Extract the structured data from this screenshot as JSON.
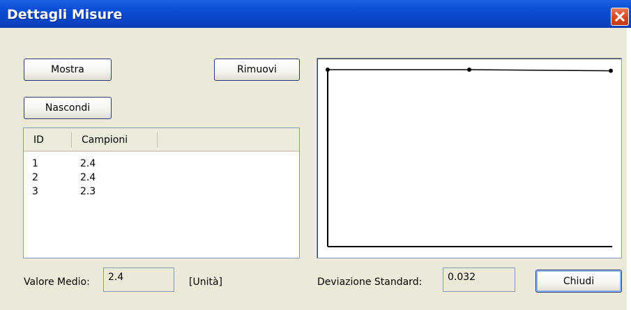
{
  "window": {
    "title": "Dettagli Misure"
  },
  "buttons": {
    "show": "Mostra",
    "remove": "Rimuovi",
    "hide": "Nascondi",
    "close": "Chiudi"
  },
  "table": {
    "columns": [
      "ID",
      "Campioni"
    ],
    "rows": [
      {
        "id": "1",
        "value": "2.4"
      },
      {
        "id": "2",
        "value": "2.4"
      },
      {
        "id": "3",
        "value": "2.3"
      }
    ]
  },
  "stats": {
    "mean_label": "Valore Medio:",
    "mean_value": "2.4",
    "unit": "[Unità]",
    "stddev_label": "Deviazione Standard:",
    "stddev_value": "0.032"
  },
  "chart_data": {
    "type": "line",
    "x": [
      1,
      2,
      3
    ],
    "values": [
      2.4,
      2.4,
      2.3
    ],
    "title": "",
    "xlabel": "",
    "ylabel": "",
    "grid": false
  },
  "colors": {
    "titlebar": "#0a47c9",
    "dialog_bg": "#ece9d8",
    "close_button": "#d8481f",
    "border": "#7f9db9"
  }
}
